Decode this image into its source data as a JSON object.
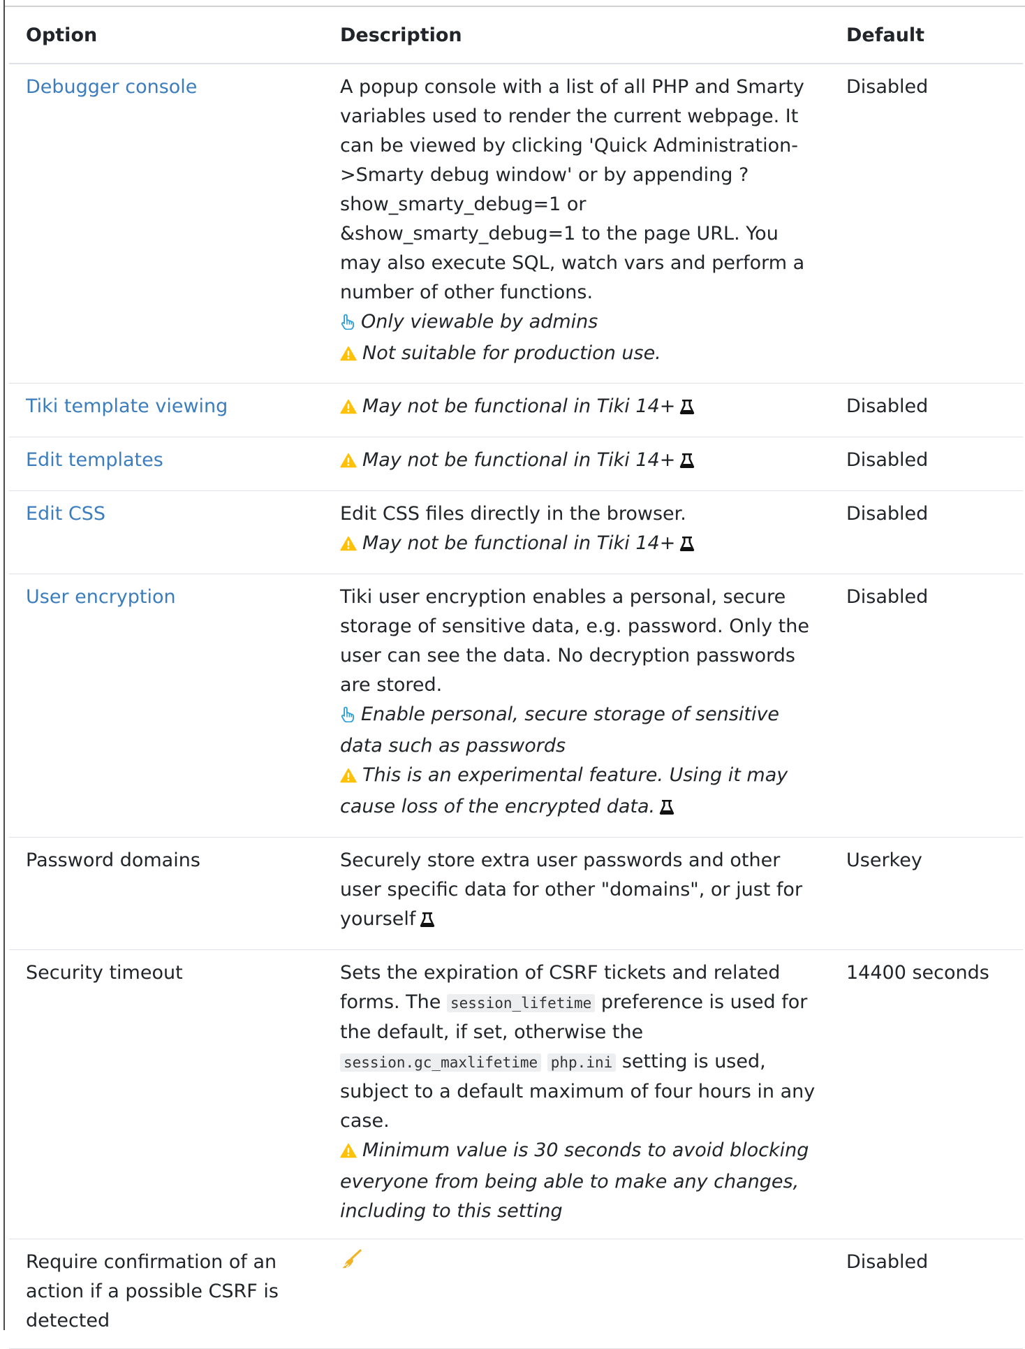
{
  "colors": {
    "link": "#3b7dbd",
    "warning": "#ffc107",
    "hand": "#2a9fd6",
    "text": "#212529",
    "rule": "#dee2e6"
  },
  "headers": {
    "option": "Option",
    "description": "Description",
    "default": "Default"
  },
  "rows": [
    {
      "option": "Debugger console",
      "desc": "A popup console with a list of all PHP and Smarty variables used to render the current webpage. It can be viewed by clicking 'Quick Administration->Smarty debug window' or by appending ?show_smarty_debug=1 or &show_smarty_debug=1 to the page URL. You may also execute SQL, watch vars and perform a number of other functions.",
      "hint": "Only viewable by admins",
      "warning": "Not suitable for production use.",
      "default": "Disabled"
    },
    {
      "option": "Tiki template viewing",
      "warning": "May not be functional in Tiki 14+",
      "default": "Disabled"
    },
    {
      "option": "Edit templates",
      "warning": "May not be functional in Tiki 14+",
      "default": "Disabled"
    },
    {
      "option": "Edit CSS",
      "desc": "Edit CSS files directly in the browser.",
      "warning": "May not be functional in Tiki 14+",
      "default": "Disabled"
    },
    {
      "option": "User encryption",
      "desc": "Tiki user encryption enables a personal, secure storage of sensitive data, e.g. password. Only the user can see the data. No decryption passwords are stored.",
      "hint": "Enable personal, secure storage of sensitive data such as passwords",
      "warning": "This is an experimental feature. Using it may cause loss of the encrypted data.",
      "default": "Disabled"
    },
    {
      "option": "Password domains",
      "desc": "Securely store extra user passwords and other user specific data for other \"domains\", or just for yourself",
      "default": "Userkey"
    },
    {
      "option": "Security timeout",
      "desc_a": "Sets the expiration of CSRF tickets and related forms. The",
      "code1": "session_lifetime",
      "desc_b": "preference is used for the default, if set, otherwise the",
      "code2": "session.gc_maxlifetime",
      "code3": "php.ini",
      "desc_c": "setting is used, subject to a default maximum of four hours in any case.",
      "warning": "Minimum value is 30 seconds to avoid blocking everyone from being able to make any changes, including to this setting",
      "default": "14400 seconds"
    },
    {
      "option": "Require confirmation of an action if a possible CSRF is detected",
      "default": "Disabled"
    }
  ]
}
